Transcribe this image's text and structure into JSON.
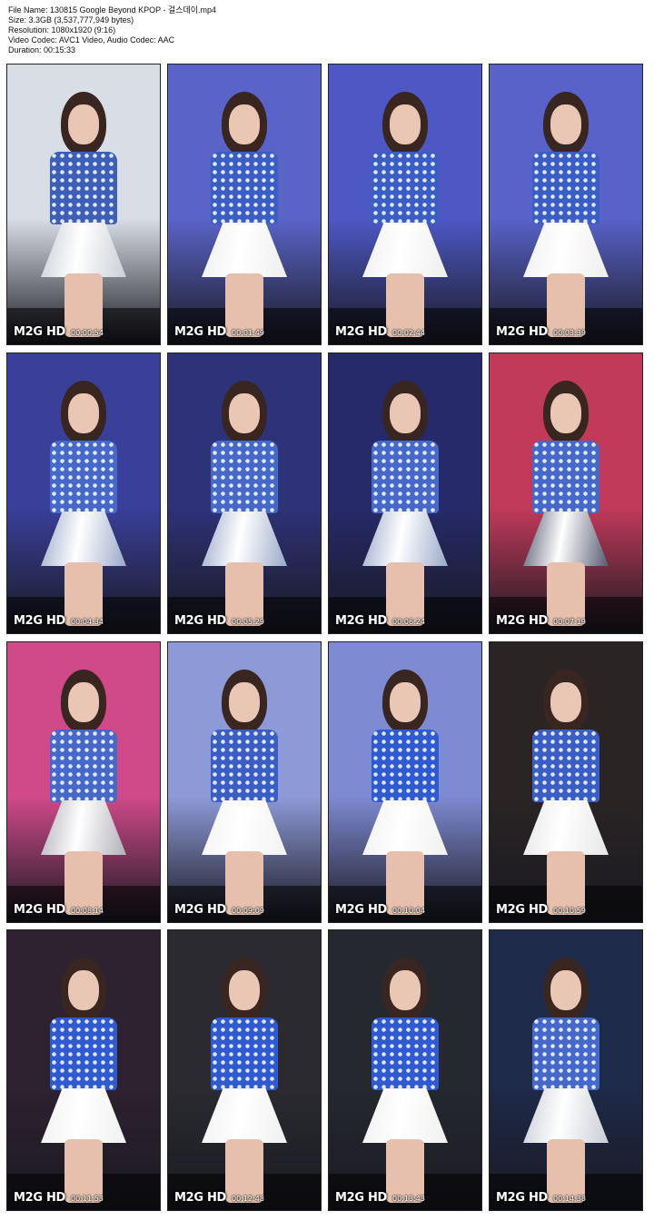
{
  "header": {
    "file_name": "File Name: 130815 Google Beyond KPOP - 걸스데이.mp4",
    "size": "Size: 3.3GB (3,537,777,949 bytes)",
    "resolution": "Resolution: 1080x1920 (9:16)",
    "codec": "Video Codec: AVC1 Video, Audio Codec: AAC",
    "duration": "Duration: 00:15:33"
  },
  "logo_text": "M2G HD",
  "thumbnails": [
    {
      "timestamp": "00:00:54",
      "bg": "#d9dde6",
      "top": "#3e5fb8",
      "skirt": "#c9cdd6"
    },
    {
      "timestamp": "00:01:49",
      "bg": "#5a64c8",
      "top": "#3a5ec4",
      "skirt": "#eeeeee"
    },
    {
      "timestamp": "00:02:44",
      "bg": "#4d58c4",
      "top": "#3a5ec4",
      "skirt": "#eeeeee"
    },
    {
      "timestamp": "00:03:39",
      "bg": "#5862c8",
      "top": "#3a5ec4",
      "skirt": "#eeeeee"
    },
    {
      "timestamp": "00:04:34",
      "bg": "#3a3f9a",
      "top": "#4668c8",
      "skirt": "#9aa8c8"
    },
    {
      "timestamp": "00:05:29",
      "bg": "#2e3278",
      "top": "#4668c8",
      "skirt": "#9aa8c8"
    },
    {
      "timestamp": "00:06:24",
      "bg": "#262a6a",
      "top": "#4668c8",
      "skirt": "#9aa8c8"
    },
    {
      "timestamp": "00:07:19",
      "bg": "#c23a5a",
      "top": "#4668c8",
      "skirt": "#555a70"
    },
    {
      "timestamp": "00:08:14",
      "bg": "#d04a8a",
      "top": "#4668c8",
      "skirt": "#b0b0b8"
    },
    {
      "timestamp": "00:09:09",
      "bg": "#8e9ad8",
      "top": "#3a5ec4",
      "skirt": "#f2f2f2"
    },
    {
      "timestamp": "00:10:04",
      "bg": "#7e8ad2",
      "top": "#2f5ad0",
      "skirt": "#f0f0f0"
    },
    {
      "timestamp": "00:10:59",
      "bg": "#2a2424",
      "top": "#3a5ec4",
      "skirt": "#e6e6e6"
    },
    {
      "timestamp": "00:11:53",
      "bg": "#2e2230",
      "top": "#2f5ad0",
      "skirt": "#f0f0f0"
    },
    {
      "timestamp": "00:12:48",
      "bg": "#2a2a30",
      "top": "#2f5ad0",
      "skirt": "#f0f0f0"
    },
    {
      "timestamp": "00:13:43",
      "bg": "#262830",
      "top": "#2f5ad0",
      "skirt": "#f0f0f0"
    },
    {
      "timestamp": "00:14:38",
      "bg": "#1e2a4a",
      "top": "#4668c8",
      "skirt": "#c8ccd6"
    }
  ]
}
